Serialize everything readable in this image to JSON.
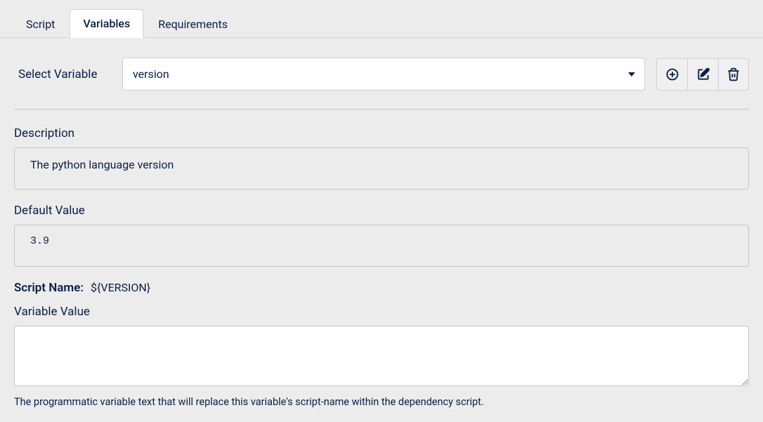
{
  "tabs": {
    "script": "Script",
    "variables": "Variables",
    "requirements": "Requirements"
  },
  "select": {
    "label": "Select Variable",
    "value": "version"
  },
  "description": {
    "label": "Description",
    "value": "The python language version"
  },
  "defaultValue": {
    "label": "Default Value",
    "value": "3.9"
  },
  "scriptName": {
    "label": "Script Name:",
    "value": "${VERSION}"
  },
  "variableValue": {
    "label": "Variable Value",
    "value": "",
    "help": "The programmatic variable text that will replace this variable's script-name within the dependency script."
  }
}
